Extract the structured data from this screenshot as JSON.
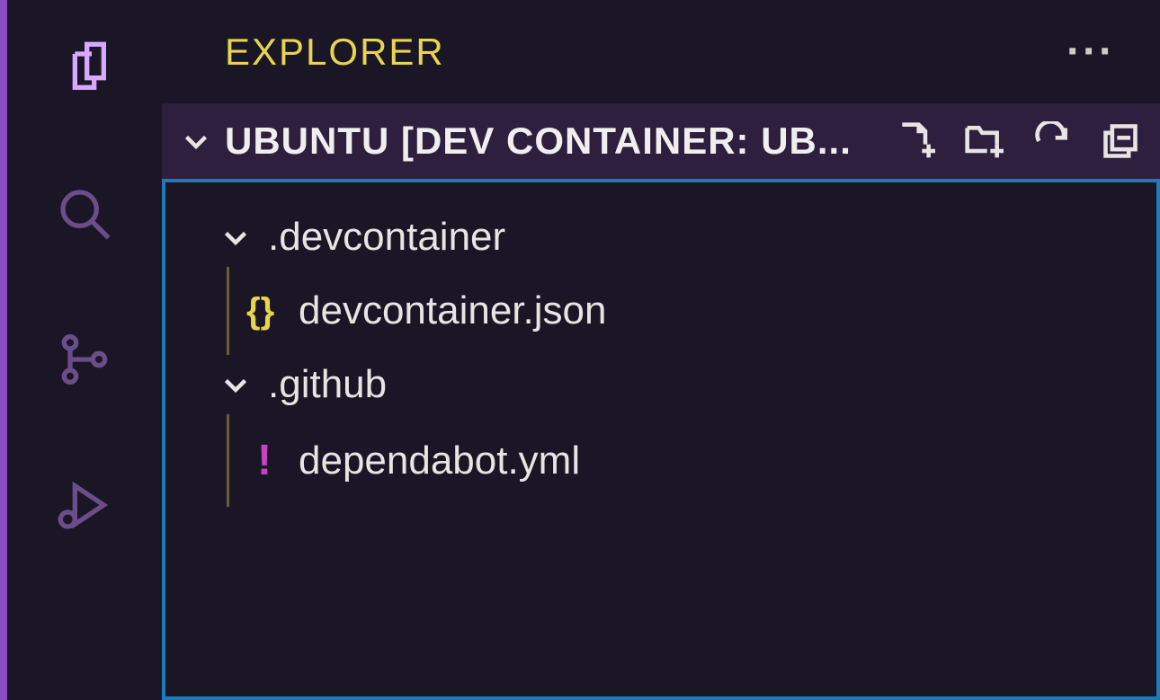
{
  "sidebar": {
    "title": "EXPLORER"
  },
  "workspace": {
    "name": "UBUNTU [DEV CONTAINER: UB..."
  },
  "tree": {
    "folders": [
      {
        "name": ".devcontainer",
        "files": [
          {
            "name": "devcontainer.json",
            "icon": "{}"
          }
        ]
      },
      {
        "name": ".github",
        "files": [
          {
            "name": "dependabot.yml",
            "icon": "!"
          }
        ]
      }
    ]
  }
}
